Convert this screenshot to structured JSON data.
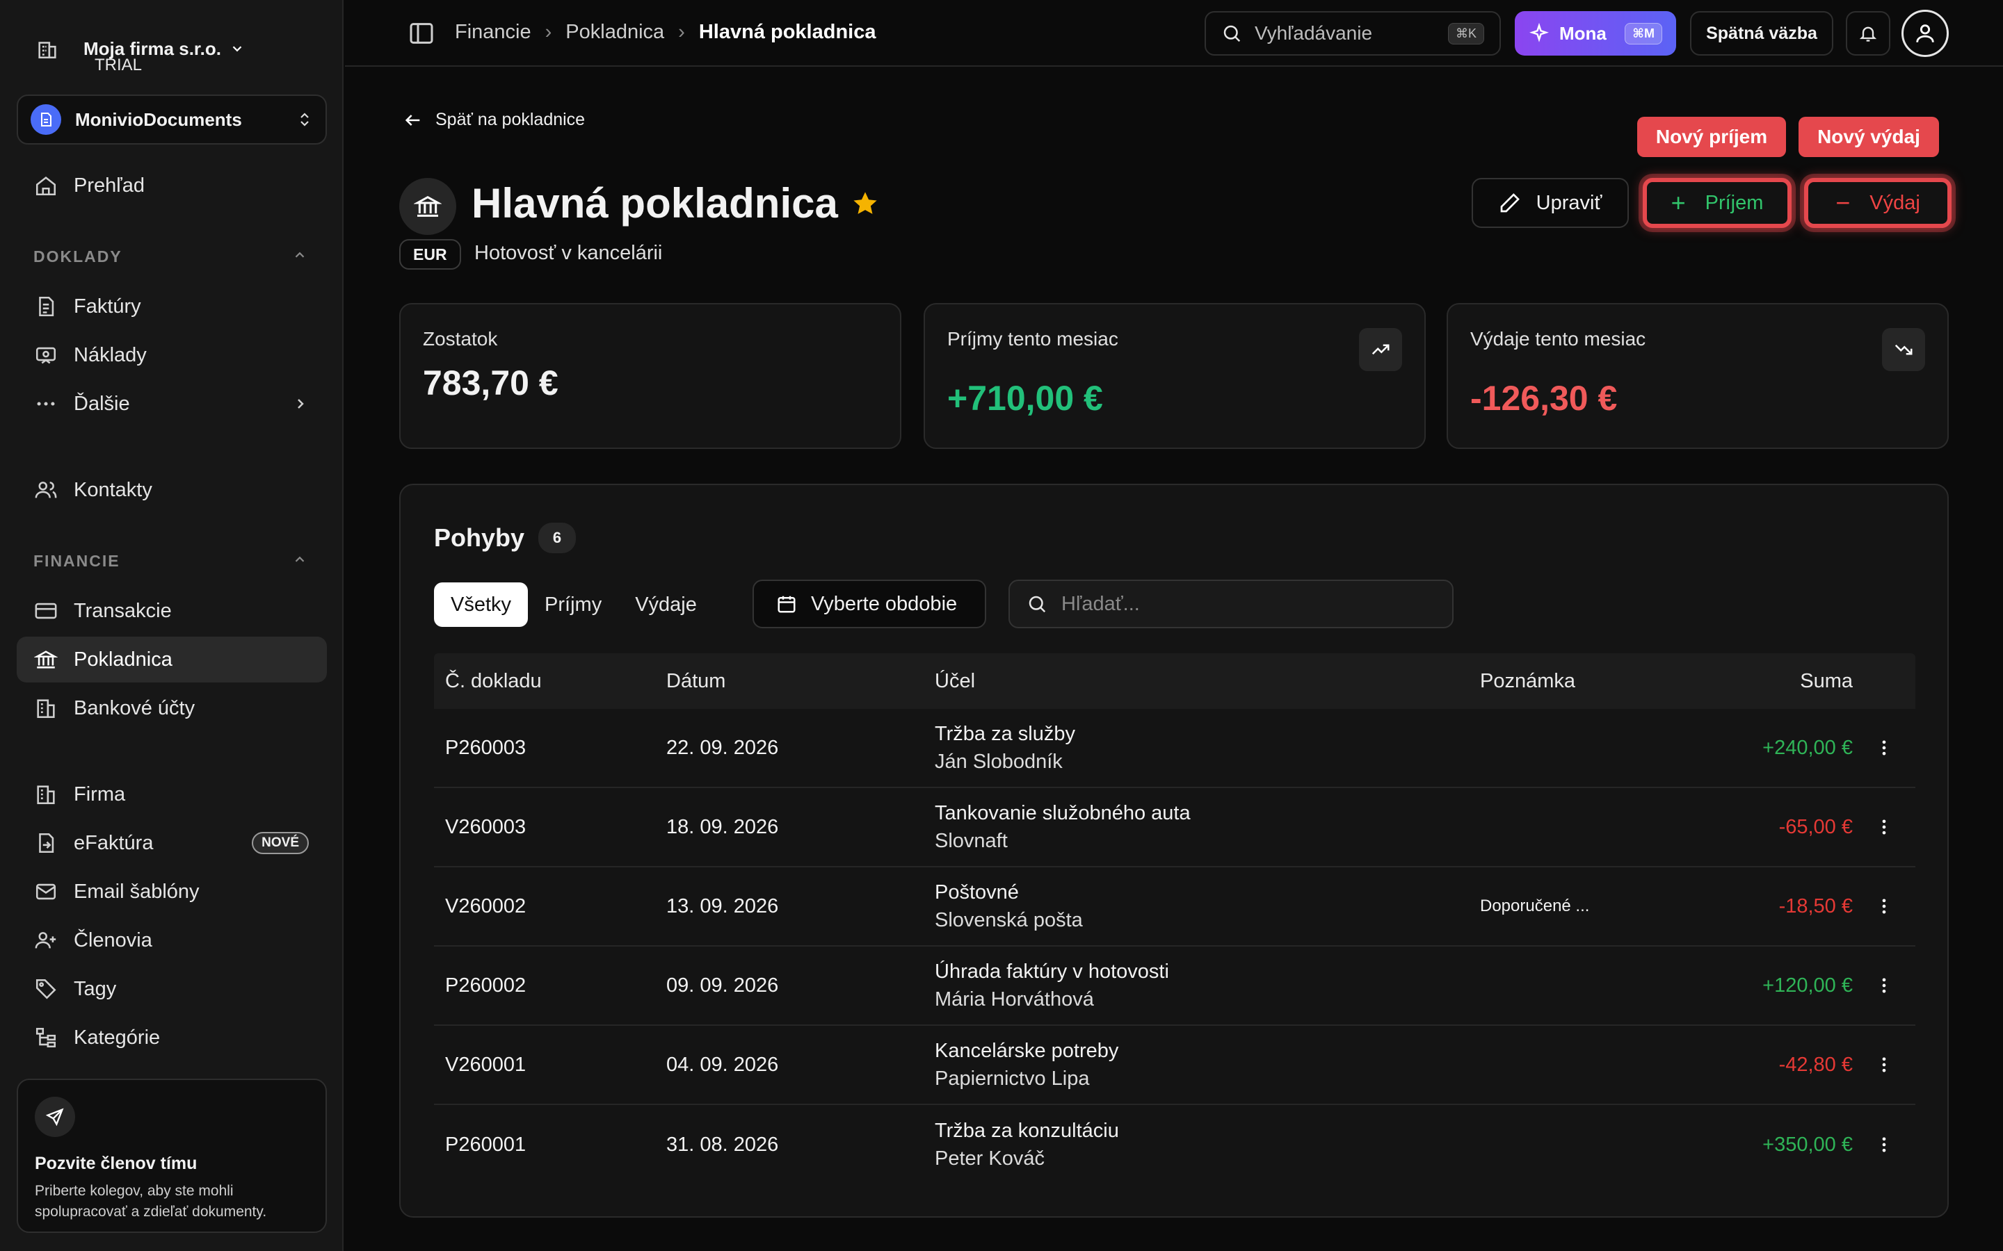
{
  "sidebar": {
    "company_name": "Moja firma s.r.o.",
    "company_plan": "TRIAL",
    "workspace": "MonivioDocuments",
    "overview": "Prehľad",
    "section_doklady": "DOKLADY",
    "faktury": "Faktúry",
    "naklady": "Náklady",
    "dalsie": "Ďalšie",
    "kontakty": "Kontakty",
    "section_financie": "FINANCIE",
    "transakcie": "Transakcie",
    "pokladnica": "Pokladnica",
    "bankove_ucty": "Bankové účty",
    "firma": "Firma",
    "efaktura": "eFaktúra",
    "efaktura_badge": "NOVÉ",
    "email_sablony": "Email šablóny",
    "clenovia": "Členovia",
    "tagy": "Tagy",
    "kategorie": "Kategórie",
    "invite_title": "Pozvite členov tímu",
    "invite_text": "Priberte kolegov, aby ste mohli spolupracovať a zdieľať dokumenty."
  },
  "topbar": {
    "crumb_1": "Financie",
    "crumb_2": "Pokladnica",
    "crumb_3": "Hlavná pokladnica",
    "search_placeholder": "Vyhľadávanie",
    "search_kbd": "⌘K",
    "mona_label": "Mona",
    "mona_kbd": "⌘M",
    "feedback": "Spätná väzba"
  },
  "header": {
    "back": "Späť na pokladnice",
    "title": "Hlavná pokladnica",
    "currency": "EUR",
    "description": "Hotovosť v kancelárii",
    "edit": "Upraviť",
    "income_btn": "Príjem",
    "expense_btn": "Výdaj",
    "new_income_tag": "Nový príjem",
    "new_expense_tag": "Nový výdaj"
  },
  "cards": {
    "balance_label": "Zostatok",
    "balance_value": "783,70 €",
    "income_label": "Príjmy tento mesiac",
    "income_value": "+710,00 €",
    "expense_label": "Výdaje tento mesiac",
    "expense_value": "-126,30 €"
  },
  "movements": {
    "title": "Pohyby",
    "count": "6",
    "tab_all": "Všetky",
    "tab_income": "Príjmy",
    "tab_expense": "Výdaje",
    "period": "Vyberte obdobie",
    "search_placeholder": "Hľadať...",
    "columns": {
      "doc": "Č. dokladu",
      "date": "Dátum",
      "purpose": "Účel",
      "note": "Poznámka",
      "sum": "Suma"
    },
    "rows": [
      {
        "doc": "P260003",
        "date": "22. 09. 2026",
        "purpose": "Tržba za služby",
        "party": "Ján Slobodník",
        "note": "",
        "sum": "+240,00 €"
      },
      {
        "doc": "V260003",
        "date": "18. 09. 2026",
        "purpose": "Tankovanie služobného auta",
        "party": "Slovnaft",
        "note": "",
        "sum": "-65,00 €"
      },
      {
        "doc": "V260002",
        "date": "13. 09. 2026",
        "purpose": "Poštovné",
        "party": "Slovenská pošta",
        "note": "Doporučené ...",
        "sum": "-18,50 €"
      },
      {
        "doc": "P260002",
        "date": "09. 09. 2026",
        "purpose": "Úhrada faktúry v hotovosti",
        "party": "Mária Horváthová",
        "note": "",
        "sum": "+120,00 €"
      },
      {
        "doc": "V260001",
        "date": "04. 09. 2026",
        "purpose": "Kancelárske potreby",
        "party": "Papiernictvo Lipa",
        "note": "",
        "sum": "-42,80 €"
      },
      {
        "doc": "P260001",
        "date": "31. 08. 2026",
        "purpose": "Tržba za konzultáciu",
        "party": "Peter Kováč",
        "note": "",
        "sum": "+350,00 €"
      }
    ]
  },
  "colors": {
    "positive": "#2fb457",
    "negative": "#e53935",
    "accent_red": "#e5484d",
    "star": "#f5b301"
  }
}
